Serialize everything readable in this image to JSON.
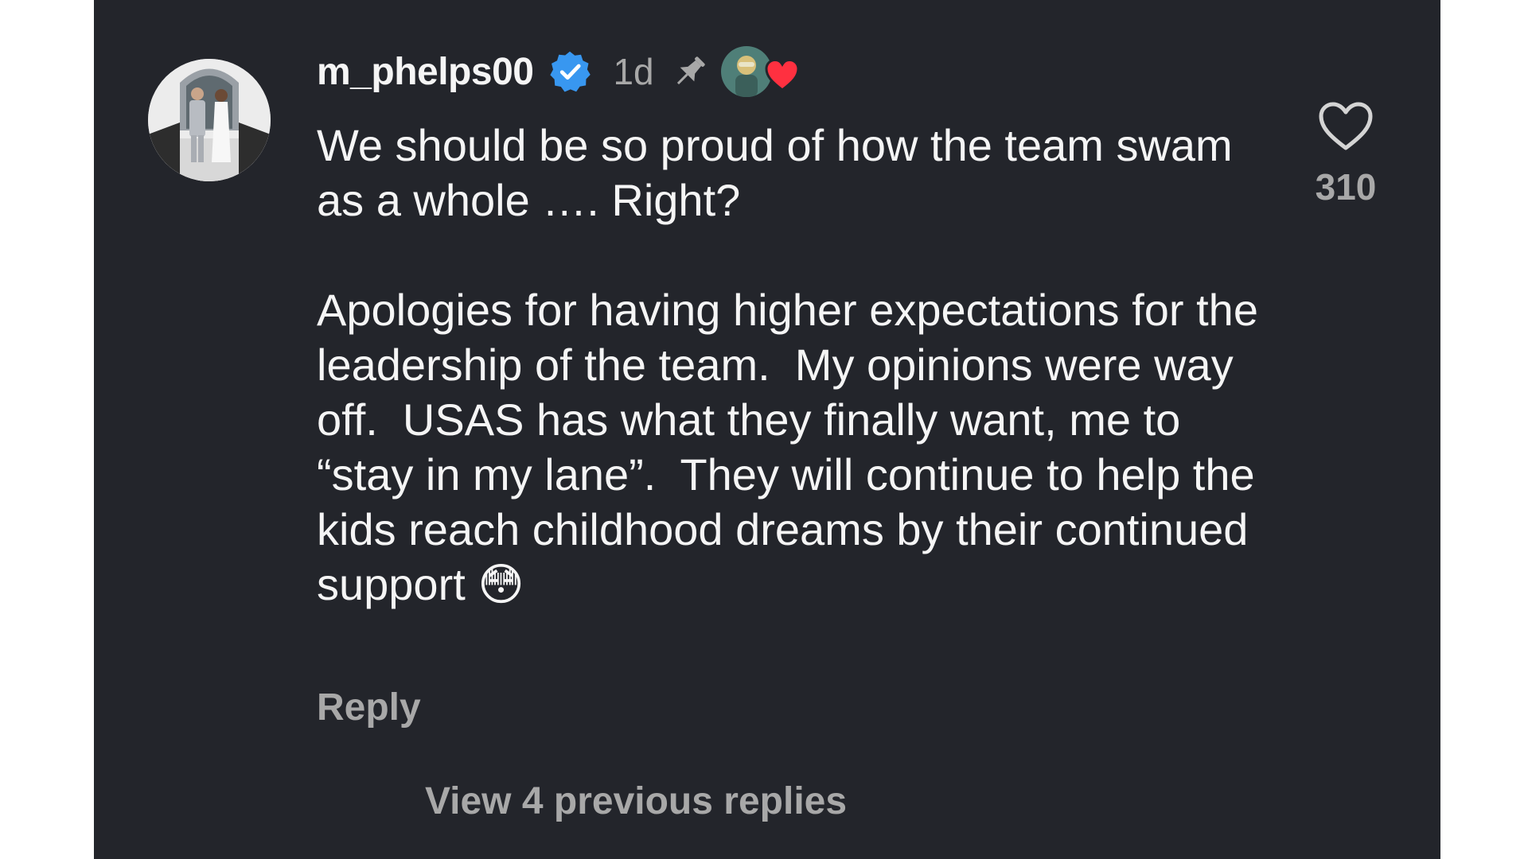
{
  "comment": {
    "username": "m_phelps00",
    "verified": true,
    "timestamp": "1d",
    "pinned": true,
    "liked_by_creator": true,
    "text": "We should be so proud of how the team swam as a whole …. Right?\n\nApologies for having higher expectations for the leadership of the team.  My opinions were way off.  USAS has what they finally want, me to “stay in my lane”.  They will continue to help the kids reach childhood dreams by their continued support 😳",
    "reply_label": "Reply",
    "like_count": "310"
  },
  "replies": {
    "view_label": "View 4 previous replies"
  },
  "icons": {
    "verified": "verified-badge-icon",
    "pin": "pin-icon",
    "creator_heart": "heart-filled-icon",
    "like": "heart-outline-icon"
  },
  "colors": {
    "background": "#23252b",
    "text_primary": "#f5f5f5",
    "text_secondary": "#a8a8a8",
    "verified_blue": "#3897f0",
    "heart_red": "#ff3040"
  }
}
